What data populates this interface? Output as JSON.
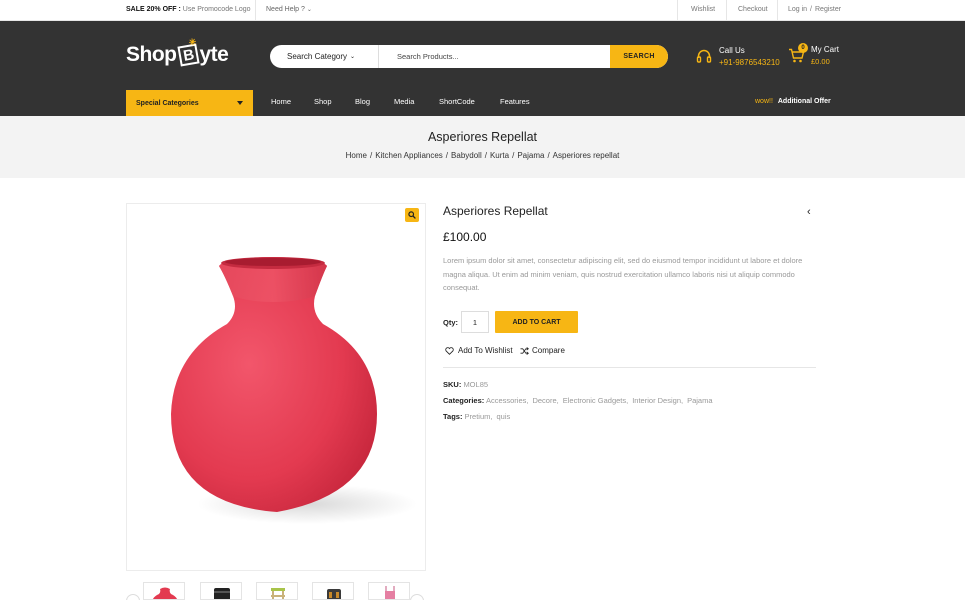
{
  "topbar": {
    "promo_bold": "SALE 20% OFF :",
    "promo_text": "Use Promocode Logo",
    "help": "Need Help ?",
    "wishlist": "Wishlist",
    "checkout": "Checkout",
    "login": "Log in",
    "slash": "/",
    "register": "Register"
  },
  "header": {
    "logo_left": "Shop",
    "logo_mid": "B",
    "logo_right": "yte",
    "search_category": "Search Category",
    "search_placeholder": "Search Products...",
    "search_button": "SEARCH",
    "call_label": "Call Us",
    "call_number": "+91-9876543210",
    "cart_label": "My Cart",
    "cart_total": "£0.00",
    "cart_count": "0"
  },
  "nav": {
    "special": "Special Categories",
    "items": [
      "Home",
      "Shop",
      "Blog",
      "Media",
      "ShortCode",
      "Features"
    ],
    "offer_wow": "wow!!",
    "offer_text": "Additional Offer"
  },
  "band": {
    "title": "Asperiores Repellat",
    "crumbs": [
      "Home",
      "Kitchen Appliances",
      "Babydoll",
      "Kurta",
      "Pajama",
      "Asperiores repellat"
    ]
  },
  "product": {
    "title": "Asperiores Repellat",
    "price": "£100.00",
    "description": "Lorem ipsum dolor sit amet, consectetur adipiscing elit, sed do eiusmod tempor incididunt ut labore et dolore magna aliqua. Ut enim ad minim veniam, quis nostrud exercitation ullamco laboris nisi ut aliquip commodo consequat.",
    "qty_label": "Qty:",
    "qty_value": "1",
    "add_to_cart": "ADD TO CART",
    "wishlist": "Add To Wishlist",
    "compare": "Compare",
    "sku_label": "SKU:",
    "sku_value": "MOL85",
    "categories_label": "Categories:",
    "categories": [
      "Accessories",
      "Decore",
      "Electronic Gadgets",
      "Interior Design",
      "Pajama"
    ],
    "tags_label": "Tags:",
    "tags": [
      "Pretium",
      "quis"
    ]
  },
  "colors": {
    "accent": "#f7b614",
    "header_bg": "#333333",
    "band_bg": "#f3f3f3",
    "vase": "#e8384f"
  }
}
